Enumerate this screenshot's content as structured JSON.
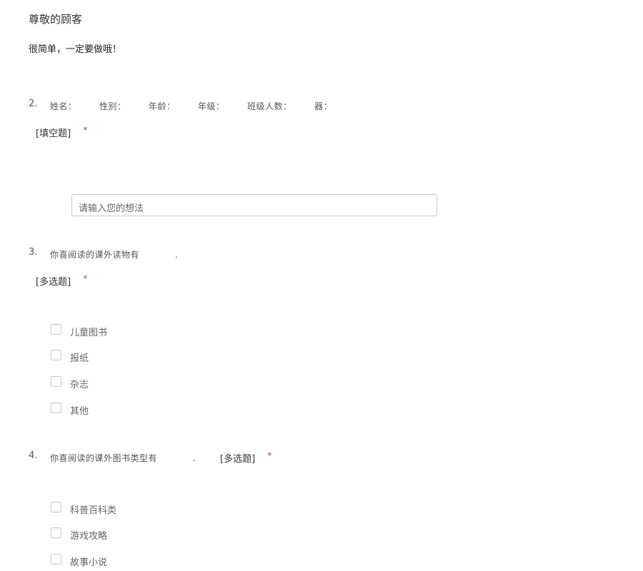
{
  "header": {
    "greeting": "尊敬的顾客",
    "intro": "很简单，一定要做哦！"
  },
  "questions": [
    {
      "number": "2.",
      "text": "姓名：　　　性别：　　　年龄：　　　年级：　　　班级人数：　　　器：",
      "type": "[填空题]",
      "required_mark": "*",
      "input": {
        "placeholder": "请输入您的想法",
        "value": ""
      }
    },
    {
      "number": "3.",
      "text": "你喜阅读的课外读物有　　　　.",
      "type": "[多选题]",
      "required_mark": "*",
      "options": [
        {
          "label": "儿童图书",
          "checked": false
        },
        {
          "label": "报纸",
          "checked": false
        },
        {
          "label": "杂志",
          "checked": false
        },
        {
          "label": "其他",
          "checked": false
        }
      ]
    },
    {
      "number": "4.",
      "text": "你喜阅读的课外图书类型有　　　　.",
      "type": "[多选题]",
      "required_mark": "*",
      "options": [
        {
          "label": "科普百科类",
          "checked": false
        },
        {
          "label": "游戏攻略",
          "checked": false
        },
        {
          "label": "故事小说",
          "checked": false
        }
      ]
    }
  ],
  "colors": {
    "required": "#e94a4a",
    "border": "#cccccc",
    "text": "#333333"
  }
}
